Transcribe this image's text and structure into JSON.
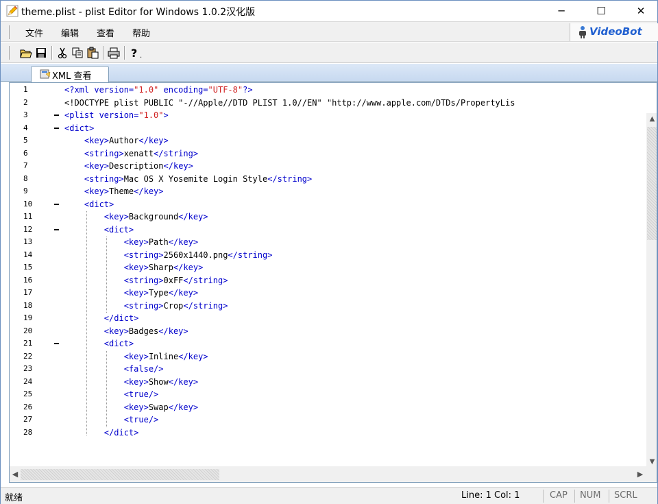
{
  "window": {
    "title": "theme.plist - plist Editor for Windows 1.0.2汉化版",
    "min_label": "─",
    "max_label": "☐",
    "close_label": "✕"
  },
  "menu": {
    "file": "文件",
    "edit": "编辑",
    "view": "查看",
    "help": "帮助",
    "logo_text": "VideoBot"
  },
  "toolbar": {
    "icons": [
      "open-folder-icon",
      "save-icon",
      "cut-icon",
      "copy-icon",
      "paste-icon",
      "print-icon",
      "help-icon"
    ]
  },
  "tabs": [
    {
      "label": "XML 查看",
      "active": true
    }
  ],
  "editor": {
    "lines": [
      {
        "n": "1",
        "text": "<?xml version=\"1.0\" encoding=\"UTF-8\"?>"
      },
      {
        "n": "2",
        "text": "<!DOCTYPE plist PUBLIC \"-//Apple//DTD PLIST 1.0//EN\" \"http://www.apple.com/DTDs/PropertyLis"
      },
      {
        "n": "3",
        "text": "<plist version=\"1.0\">"
      },
      {
        "n": "4",
        "text": "<dict>"
      },
      {
        "n": "5",
        "text": "    <key>Author</key>"
      },
      {
        "n": "6",
        "text": "    <string>xenatt</string>"
      },
      {
        "n": "7",
        "text": "    <key>Description</key>"
      },
      {
        "n": "8",
        "text": "    <string>Mac OS X Yosemite Login Style</string>"
      },
      {
        "n": "9",
        "text": "    <key>Theme</key>"
      },
      {
        "n": "10",
        "text": "    <dict>"
      },
      {
        "n": "11",
        "text": "        <key>Background</key>"
      },
      {
        "n": "12",
        "text": "        <dict>"
      },
      {
        "n": "13",
        "text": "            <key>Path</key>"
      },
      {
        "n": "14",
        "text": "            <string>2560x1440.png</string>"
      },
      {
        "n": "15",
        "text": "            <key>Sharp</key>"
      },
      {
        "n": "16",
        "text": "            <string>0xFF</string>"
      },
      {
        "n": "17",
        "text": "            <key>Type</key>"
      },
      {
        "n": "18",
        "text": "            <string>Crop</string>"
      },
      {
        "n": "19",
        "text": "        </dict>"
      },
      {
        "n": "20",
        "text": "        <key>Badges</key>"
      },
      {
        "n": "21",
        "text": "        <dict>"
      },
      {
        "n": "22",
        "text": "            <key>Inline</key>"
      },
      {
        "n": "23",
        "text": "            <false/>"
      },
      {
        "n": "24",
        "text": "            <key>Show</key>"
      },
      {
        "n": "25",
        "text": "            <true/>"
      },
      {
        "n": "26",
        "text": "            <key>Swap</key>"
      },
      {
        "n": "27",
        "text": "            <true/>"
      },
      {
        "n": "28",
        "text": "        </dict>"
      }
    ],
    "fold_lines": [
      "3",
      "4",
      "10",
      "12",
      "21"
    ],
    "tag_color": "#0000cc",
    "value_color": "#d12323"
  },
  "scrollbars": {
    "up": "▲",
    "down": "▼",
    "left": "◀",
    "right": "▶"
  },
  "status": {
    "ready": "就绪",
    "position": "Line: 1 Col: 1",
    "cap": "CAP",
    "num": "NUM",
    "scrl": "SCRL"
  }
}
